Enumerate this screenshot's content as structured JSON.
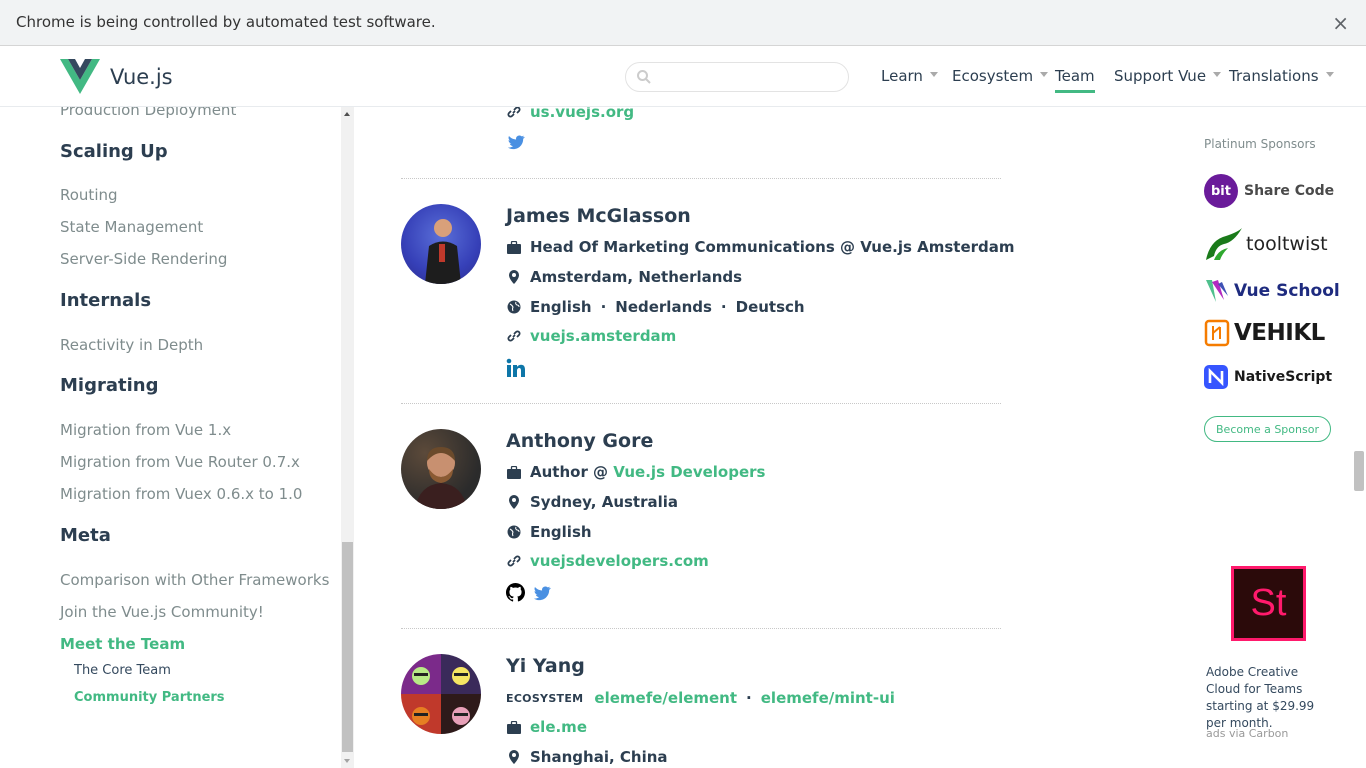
{
  "infobar": {
    "message": "Chrome is being controlled by automated test software.",
    "close": "×"
  },
  "header": {
    "brand": "Vue.js",
    "search_placeholder": "",
    "nav": [
      {
        "label": "Learn",
        "dropdown": true
      },
      {
        "label": "Ecosystem",
        "dropdown": true
      },
      {
        "label": "Team",
        "dropdown": false,
        "active": true
      },
      {
        "label": "Support Vue",
        "dropdown": true
      },
      {
        "label": "Translations",
        "dropdown": true
      }
    ]
  },
  "sidebar": {
    "top_partial": "Production Deployment",
    "sections": [
      {
        "title": "Scaling Up",
        "items": [
          "Routing",
          "State Management",
          "Server-Side Rendering"
        ]
      },
      {
        "title": "Internals",
        "items": [
          "Reactivity in Depth"
        ]
      },
      {
        "title": "Migrating",
        "items": [
          "Migration from Vue 1.x",
          "Migration from Vue Router 0.7.x",
          "Migration from Vuex 0.6.x to 1.0"
        ]
      },
      {
        "title": "Meta",
        "items": [
          "Comparison with Other Frameworks",
          "Join the Vue.js Community!",
          "Meet the Team"
        ]
      }
    ],
    "subitems": [
      "The Core Team",
      "Community Partners"
    ]
  },
  "main": {
    "top_partial": {
      "link": "us.vuejs.org"
    },
    "members": [
      {
        "name": "James McGlasson",
        "work": "Head Of Marketing Communications @ Vue.js Amsterdam",
        "location": "Amsterdam, Netherlands",
        "languages": [
          "English",
          "Nederlands",
          "Deutsch"
        ],
        "link": "vuejs.amsterdam",
        "social": [
          "linkedin-icon"
        ]
      },
      {
        "name": "Anthony Gore",
        "work_prefix": "Author @ ",
        "work_link": "Vue.js Developers",
        "location": "Sydney, Australia",
        "languages": [
          "English"
        ],
        "link": "vuejsdevelopers.com",
        "social": [
          "github-icon",
          "twitter-icon"
        ]
      },
      {
        "name": "Yi Yang",
        "ecosystem_label": "ECOSYSTEM",
        "ecosystem": [
          "elemefe/element",
          "elemefe/mint-ui"
        ],
        "work_link": "ele.me",
        "location": "Shanghai, China"
      }
    ],
    "dot": "·"
  },
  "sponsors": {
    "title": "Platinum Sponsors",
    "items": [
      {
        "name": "Share Code",
        "badge": "bit",
        "color": "#4a4a4a"
      },
      {
        "name": "tooltwist",
        "color": "#222222"
      },
      {
        "name": "Vue School",
        "color": "#1e2b7f"
      },
      {
        "name": "VEHIKL",
        "color": "#1a1a1a"
      },
      {
        "name": "NativeScript",
        "color": "#1a1a1a"
      }
    ],
    "become": "Become a Sponsor",
    "ad_logo": "St",
    "ad_text": "Adobe Creative Cloud for Teams starting at $29.99 per month.",
    "ad_via": "ads via Carbon"
  },
  "colors": {
    "accent": "#42b983",
    "text": "#2c3e50",
    "muted": "#7f8c8d"
  }
}
